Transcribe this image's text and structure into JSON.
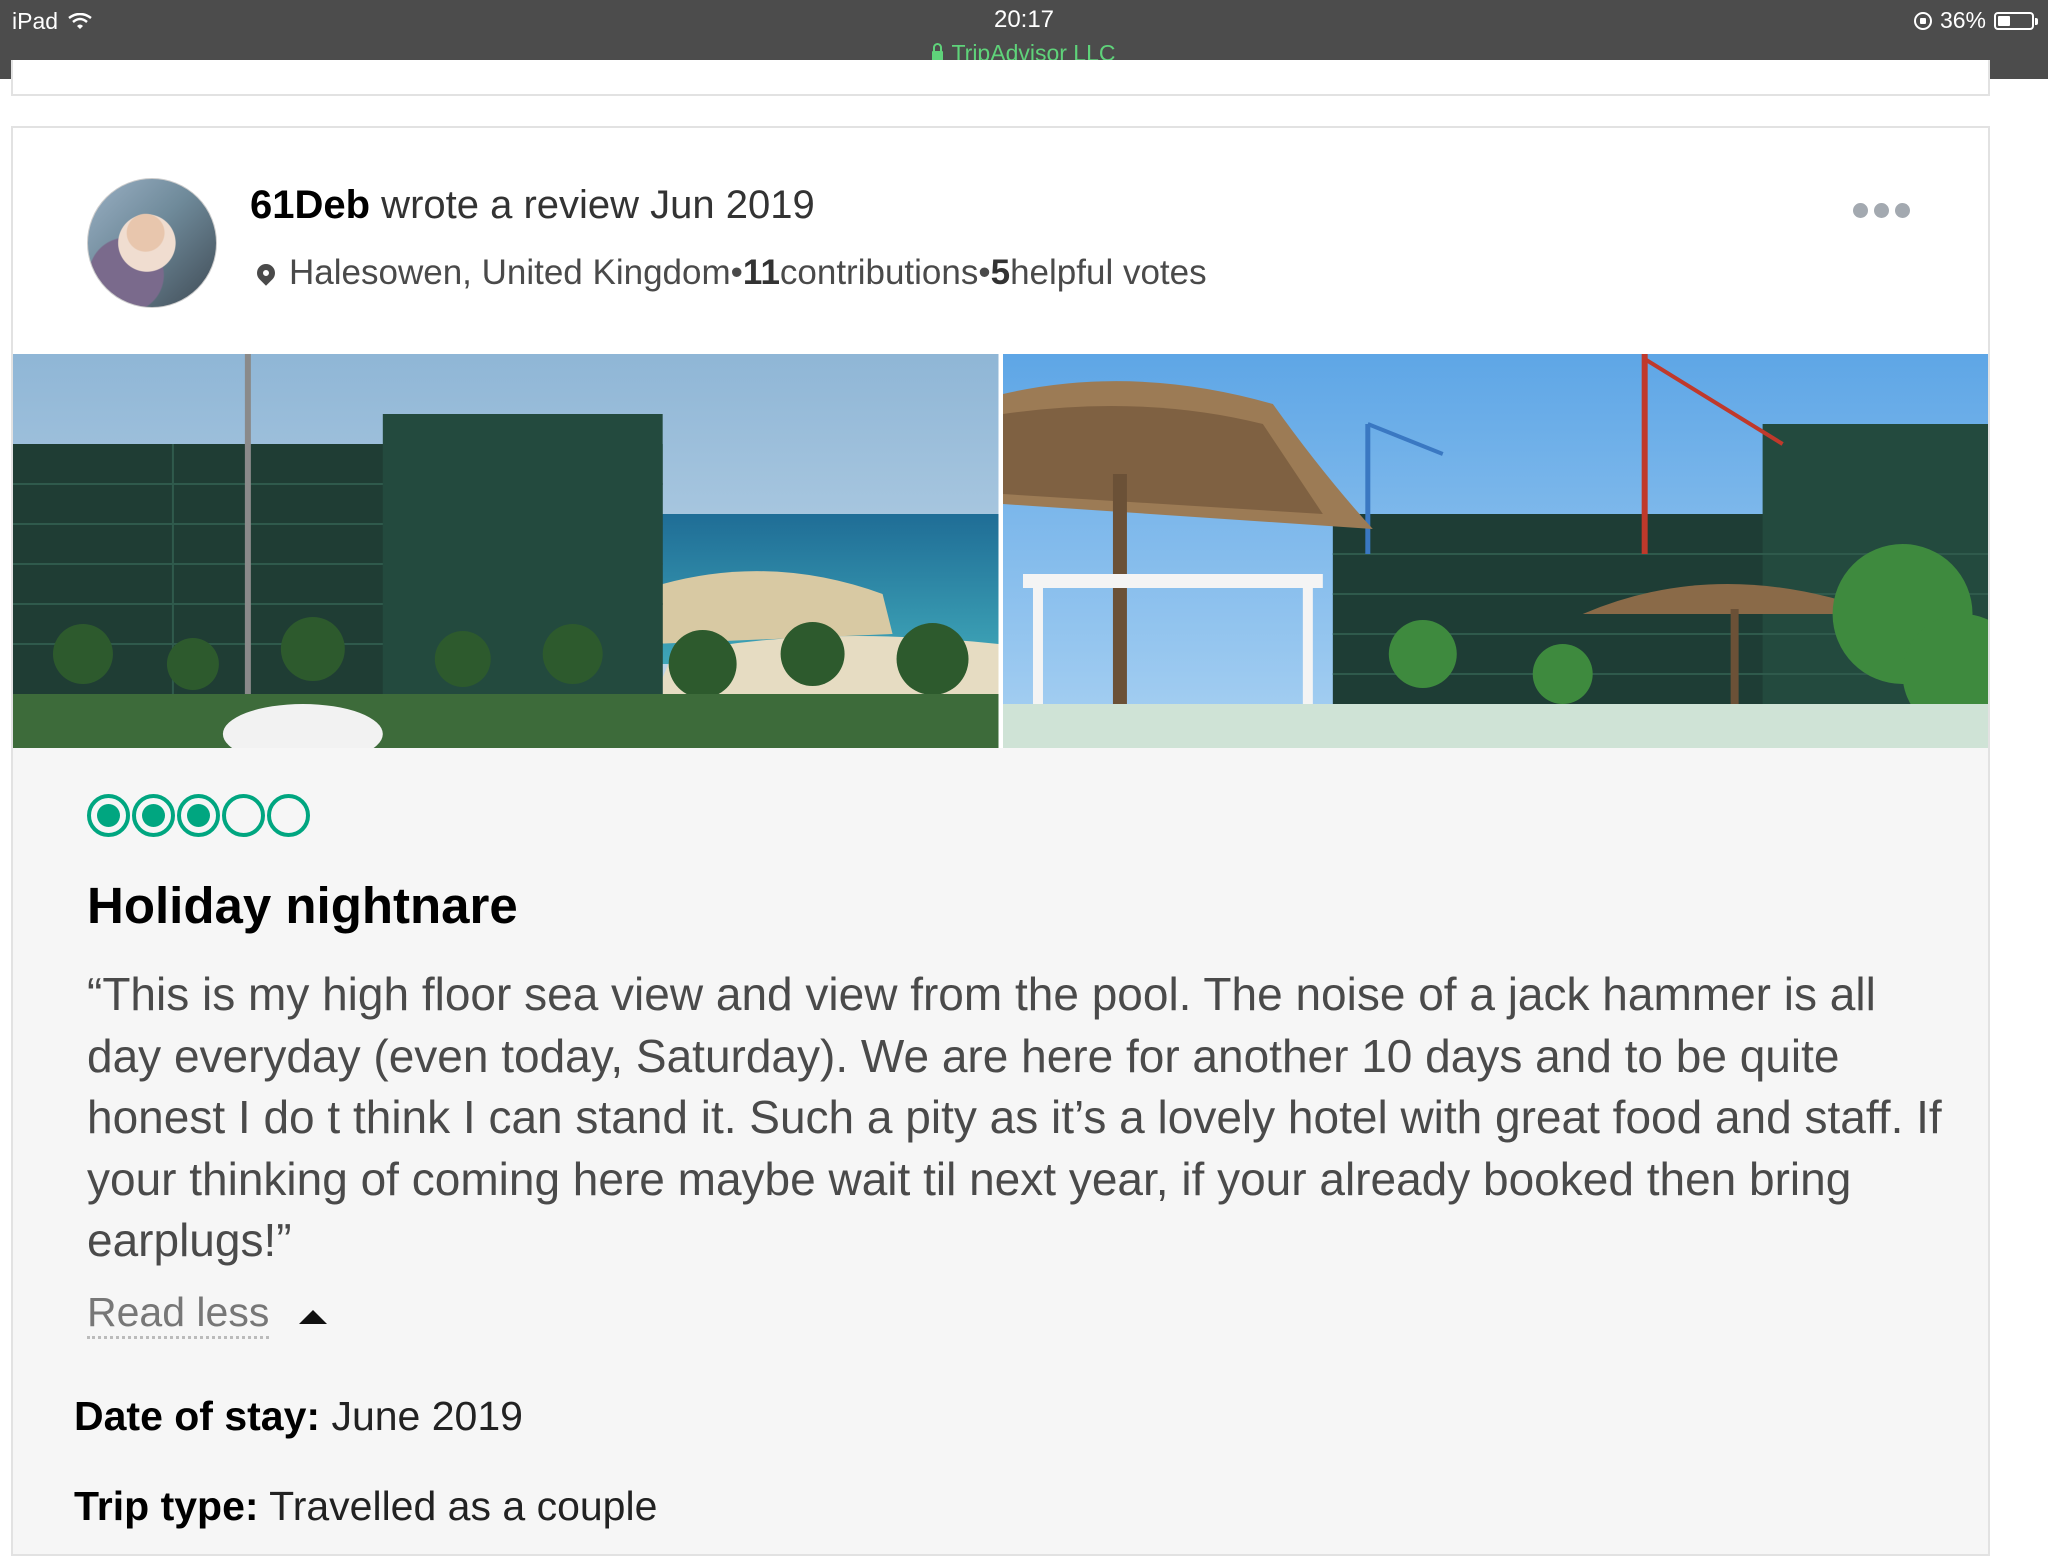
{
  "status_bar": {
    "device": "iPad",
    "time": "20:17",
    "site": "TripAdvisor LLC",
    "battery": "36%",
    "battery_level": 0.36
  },
  "review": {
    "username": "61Deb",
    "action_text": " wrote a review Jun 2019",
    "location": "Halesowen, United Kingdom",
    "sep1": " • ",
    "contributions_count": "11",
    "contributions_label": " contributions",
    "sep2": " • ",
    "helpful_count": "5",
    "helpful_label": " helpful votes",
    "rating": 3,
    "rating_max": 5,
    "title": "Holiday nightnare",
    "text": "“This is my high floor sea view and view from the pool. The noise of a jack hammer is all day everyday (even today, Saturday). We are here for another 10 days and to be quite honest I do t think I can stand it. Such a pity as it’s a lovely hotel with great food and staff. If your thinking of coming here maybe wait til next year, if your already booked then bring earplugs!”",
    "read_less": "Read less",
    "date_of_stay_label": "Date of stay:",
    "date_of_stay_value": " June 2019",
    "trip_type_label": "Trip type:",
    "trip_type_value": " Travelled as a couple"
  },
  "icons": {
    "wifi": "wifi-icon",
    "lock": "lock-icon",
    "orientation_lock": "orientation-lock-icon",
    "battery": "battery-icon",
    "location_pin": "location-pin-icon",
    "more": "more-options-icon",
    "caret_up": "caret-up-icon"
  },
  "colors": {
    "status_bar_bg": "#4c4c4c",
    "secure_url": "#5fd37a",
    "rating_green": "#00a680"
  }
}
